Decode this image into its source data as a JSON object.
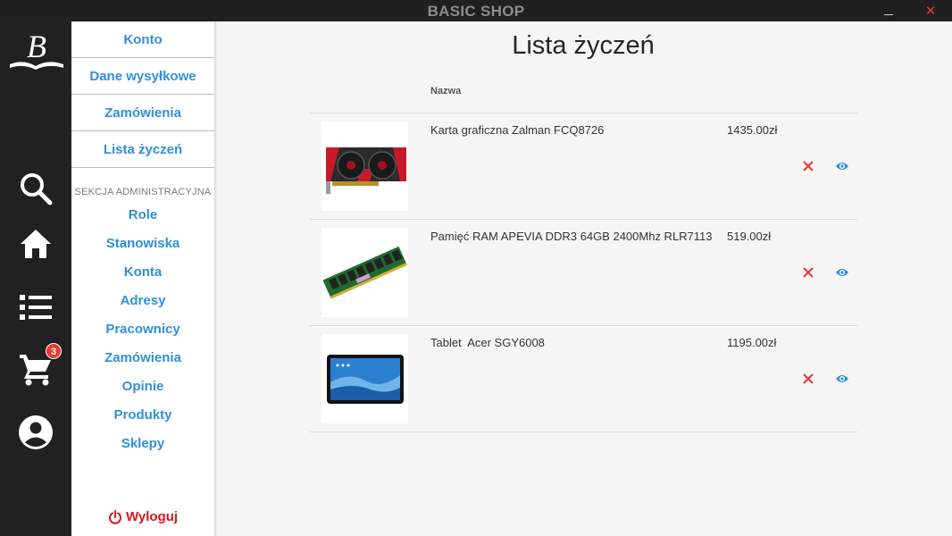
{
  "window": {
    "title": "BASIC SHOP",
    "minimize_icon": "minimize-icon",
    "close_icon": "close-icon"
  },
  "rail": {
    "logo_text": "B",
    "icons": [
      "search-icon",
      "home-icon",
      "list-icon",
      "cart-icon",
      "account-icon"
    ],
    "cart_badge": "3",
    "accent_color": "#e53935"
  },
  "side_menu": {
    "items": [
      {
        "label": "Konto"
      },
      {
        "label": "Dane wysyłkowe"
      },
      {
        "label": "Zamówienia"
      },
      {
        "label": "Lista życzeń"
      }
    ],
    "admin_header": "SEKCJA ADMINISTRACYJNA",
    "admin_items": [
      {
        "label": "Role"
      },
      {
        "label": "Stanowiska"
      },
      {
        "label": "Konta"
      },
      {
        "label": "Adresy"
      },
      {
        "label": "Pracownicy"
      },
      {
        "label": "Zamówienia"
      },
      {
        "label": "Opinie"
      },
      {
        "label": "Produkty"
      },
      {
        "label": "Sklepy"
      }
    ],
    "logout_label": "Wyloguj",
    "link_color": "#2f8fdc",
    "logout_color": "#e0141b"
  },
  "main": {
    "title": "Lista życzeń",
    "column_header": "Nazwa",
    "products": [
      {
        "name": "Karta graficzna Zalman FCQ8726",
        "price": "1435.00zł",
        "image_icon": "graphics-card-image"
      },
      {
        "name": "Pamięć RAM APEVIA DDR3 64GB 2400Mhz RLR7113",
        "price": "519.00zł",
        "image_icon": "ram-module-image"
      },
      {
        "name": "Tablet  Acer SGY6008",
        "price": "1195.00zł",
        "image_icon": "tablet-image"
      }
    ],
    "remove_icon": "remove-icon",
    "view_icon": "eye-icon"
  }
}
